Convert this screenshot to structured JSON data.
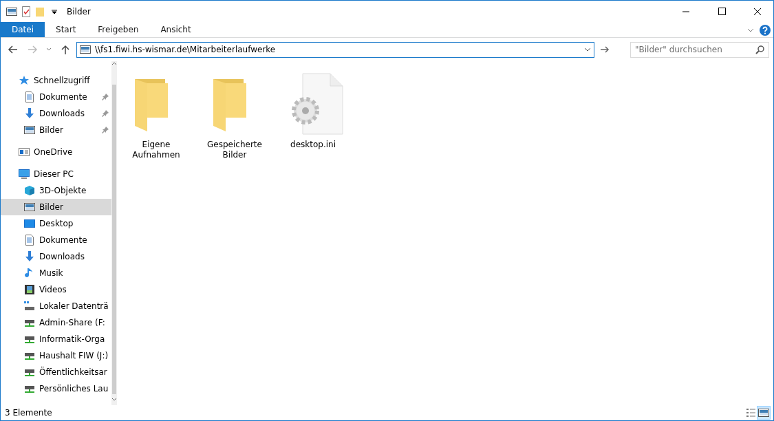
{
  "window": {
    "title": "Bilder"
  },
  "ribbon_tabs": [
    {
      "label": "Datei",
      "selected": true
    },
    {
      "label": "Start",
      "selected": false
    },
    {
      "label": "Freigeben",
      "selected": false
    },
    {
      "label": "Ansicht",
      "selected": false
    }
  ],
  "address": {
    "value": "\\\\fs1.fiwi.hs-wismar.de\\Mitarbeiterlaufwerke"
  },
  "search": {
    "placeholder": "\"Bilder\" durchsuchen"
  },
  "sidebar": {
    "items": [
      {
        "label": "Schnellzugriff",
        "kind": "star",
        "selected": false,
        "children": [
          {
            "label": "Dokumente",
            "kind": "document",
            "pinned": true,
            "selected": false
          },
          {
            "label": "Downloads",
            "kind": "download",
            "pinned": true,
            "selected": false
          },
          {
            "label": "Bilder",
            "kind": "picture",
            "pinned": true,
            "selected": false
          }
        ]
      },
      {
        "label": "OneDrive",
        "kind": "cloud",
        "selected": false
      },
      {
        "label": "Dieser PC",
        "kind": "pc",
        "selected": false,
        "children": [
          {
            "label": "3D-Objekte",
            "kind": "cube",
            "pinned": false,
            "selected": false
          },
          {
            "label": "Bilder",
            "kind": "picture",
            "pinned": false,
            "selected": true
          },
          {
            "label": "Desktop",
            "kind": "desktop",
            "pinned": false,
            "selected": false
          },
          {
            "label": "Dokumente",
            "kind": "document",
            "pinned": false,
            "selected": false
          },
          {
            "label": "Downloads",
            "kind": "download",
            "pinned": false,
            "selected": false
          },
          {
            "label": "Musik",
            "kind": "music",
            "pinned": false,
            "selected": false
          },
          {
            "label": "Videos",
            "kind": "video",
            "pinned": false,
            "selected": false
          },
          {
            "label": "Lokaler Datenträ",
            "kind": "disk",
            "pinned": false,
            "selected": false
          },
          {
            "label": "Admin-Share (F:",
            "kind": "netdrive",
            "pinned": false,
            "selected": false
          },
          {
            "label": "Informatik-Orga",
            "kind": "netdrive",
            "pinned": false,
            "selected": false
          },
          {
            "label": "Haushalt FIW (J:)",
            "kind": "netdrive",
            "pinned": false,
            "selected": false
          },
          {
            "label": "Öffentlichkeitsar",
            "kind": "netdrive",
            "pinned": false,
            "selected": false
          },
          {
            "label": "Persönliches Lau",
            "kind": "netdrive",
            "pinned": false,
            "selected": false
          }
        ]
      }
    ]
  },
  "files": [
    {
      "name": "Eigene\nAufnahmen",
      "kind": "folder"
    },
    {
      "name": "Gespeicherte\nBilder",
      "kind": "folder"
    },
    {
      "name": "desktop.ini",
      "kind": "settings"
    }
  ],
  "status_bar": {
    "text": "3 Elemente"
  },
  "view_buttons": [
    {
      "kind": "details",
      "selected": false
    },
    {
      "kind": "large-icons",
      "selected": true
    }
  ]
}
